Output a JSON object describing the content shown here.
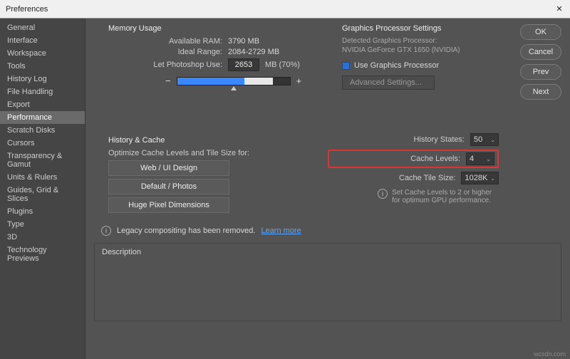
{
  "title": "Preferences",
  "sidebar": {
    "items": [
      "General",
      "Interface",
      "Workspace",
      "Tools",
      "History Log",
      "File Handling",
      "Export",
      "Performance",
      "Scratch Disks",
      "Cursors",
      "Transparency & Gamut",
      "Units & Rulers",
      "Guides, Grid & Slices",
      "Plugins",
      "Type",
      "3D",
      "Technology Previews"
    ],
    "selected": "Performance"
  },
  "buttons": {
    "ok": "OK",
    "cancel": "Cancel",
    "prev": "Prev",
    "next": "Next"
  },
  "memory": {
    "title": "Memory Usage",
    "available_label": "Available RAM:",
    "available_value": "3790 MB",
    "ideal_label": "Ideal Range:",
    "ideal_value": "2084-2729 MB",
    "use_label": "Let Photoshop Use:",
    "use_value": "2653",
    "use_unit": "MB (70%)"
  },
  "gfx": {
    "title": "Graphics Processor Settings",
    "detected_label": "Detected Graphics Processor:",
    "detected_value": "NVIDIA GeForce GTX 1650 (NVIDIA)",
    "use_gp": "Use Graphics Processor",
    "advanced": "Advanced Settings..."
  },
  "history": {
    "title": "History & Cache",
    "optimize_label": "Optimize Cache Levels and Tile Size for:",
    "opt1": "Web / UI Design",
    "opt2": "Default / Photos",
    "opt3": "Huge Pixel Dimensions",
    "states_label": "History States:",
    "states_value": "50",
    "levels_label": "Cache Levels:",
    "levels_value": "4",
    "tile_label": "Cache Tile Size:",
    "tile_value": "1028K",
    "info": "Set Cache Levels to 2 or higher for optimum GPU performance."
  },
  "legacy": {
    "text": "Legacy compositing has been removed.",
    "link": "Learn more"
  },
  "description_label": "Description",
  "watermark": "wcsdn.com"
}
